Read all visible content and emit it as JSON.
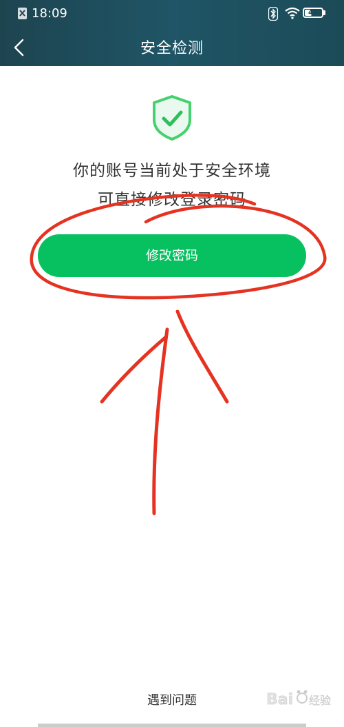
{
  "status_bar": {
    "time": "18:09",
    "battery_level": "41",
    "battery_fraction": 0.41,
    "icons": [
      "sim-icon",
      "bluetooth-icon",
      "wifi-icon",
      "battery-icon"
    ]
  },
  "header": {
    "title": "安全检测",
    "back_icon": "chevron-left-icon"
  },
  "main": {
    "status_icon": "shield-check-icon",
    "message_line1": "你的账号当前处于安全环境",
    "message_line2": "可直接修改登录密码",
    "primary_button_label": "修改密码"
  },
  "footer": {
    "help_link": "遇到问题"
  },
  "colors": {
    "header_bg": "#1e4450",
    "accent_green": "#07c160",
    "annotation_red": "#e53321"
  }
}
